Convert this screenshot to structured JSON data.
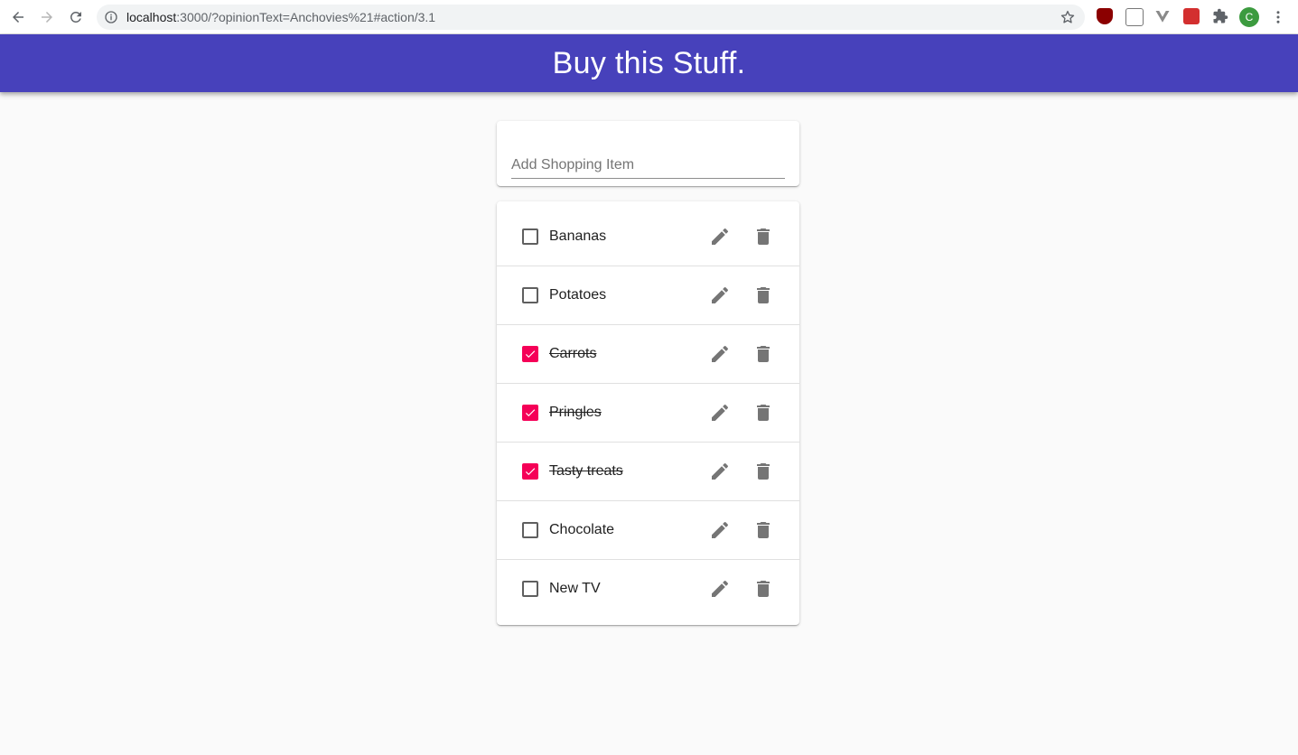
{
  "browser": {
    "url_host": "localhost",
    "url_rest": ":3000/?opinionText=Anchovies%21#action/3.1",
    "profile_initial": "C"
  },
  "app": {
    "title": "Buy this Stuff.",
    "accent_color": "#4741bb",
    "check_color": "#f50057"
  },
  "add_item": {
    "placeholder": "Add Shopping Item",
    "value": ""
  },
  "items": [
    {
      "label": "Bananas",
      "checked": false
    },
    {
      "label": "Potatoes",
      "checked": false
    },
    {
      "label": "Carrots",
      "checked": true
    },
    {
      "label": "Pringles",
      "checked": true
    },
    {
      "label": "Tasty treats",
      "checked": true
    },
    {
      "label": "Chocolate",
      "checked": false
    },
    {
      "label": "New TV",
      "checked": false
    }
  ],
  "icons": {
    "edit": "pencil-icon",
    "delete": "trash-icon",
    "check": "check-icon"
  }
}
